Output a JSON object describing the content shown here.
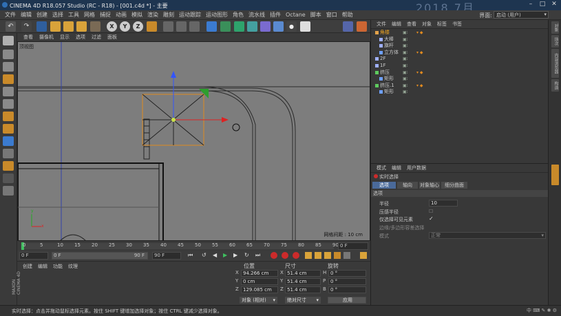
{
  "app": {
    "title": "CINEMA 4D R18.057 Studio (RC - R18) - [001.c4d *] - 主要",
    "watermark": "2018  7月"
  },
  "menu": [
    "文件",
    "编辑",
    "创建",
    "选择",
    "工具",
    "网格",
    "捕捉",
    "动画",
    "模拟",
    "渲染",
    "雕刻",
    "运动跟踪",
    "运动图形",
    "角色",
    "流水线",
    "插件",
    "Octane",
    "脚本",
    "窗口",
    "帮助"
  ],
  "layout": {
    "label": "界面:",
    "value": "启动 (用户)"
  },
  "toolbar": {
    "undo_icon": "undo-icon",
    "axis_x": "X",
    "axis_y": "Y",
    "axis_z": "Z"
  },
  "viewport": {
    "menu": [
      "查看",
      "摄像机",
      "显示",
      "选项",
      "过滤",
      "面板"
    ],
    "name": "顶视图",
    "grid_spacing": "网格间距 : 10 cm"
  },
  "timeline": {
    "ticks": [
      "0",
      "5",
      "10",
      "15",
      "20",
      "25",
      "30",
      "35",
      "40",
      "45",
      "50",
      "55",
      "60",
      "65",
      "70",
      "75",
      "80",
      "85",
      "90"
    ],
    "current": "0 F"
  },
  "transport": {
    "start": "0 F",
    "min": "0 F",
    "max": "90 F",
    "end": "90 F"
  },
  "material": {
    "menu": [
      "创建",
      "编辑",
      "功能",
      "纹理"
    ],
    "logo_line1": "MAXON",
    "logo_line2": "CINEMA 4D"
  },
  "coords": {
    "headers": {
      "pos": "位置",
      "size": "尺寸",
      "rot": "旋转"
    },
    "rows": [
      {
        "axis": "X",
        "pos": "94.266 cm",
        "saxis": "X",
        "size": "51.4 cm",
        "raxis": "H",
        "rot": "0 °"
      },
      {
        "axis": "Y",
        "pos": "0 cm",
        "saxis": "Y",
        "size": "51.4 cm",
        "raxis": "P",
        "rot": "0 °"
      },
      {
        "axis": "Z",
        "pos": "129.085 cm",
        "saxis": "Z",
        "size": "51.4 cm",
        "raxis": "B",
        "rot": "0 °"
      }
    ],
    "mode": "对象 (相对)",
    "size_mode": "绝对尺寸",
    "apply": "应用"
  },
  "objects": {
    "menu": [
      "文件",
      "编辑",
      "查看",
      "对象",
      "标签",
      "书签"
    ],
    "items": [
      {
        "name": "角楼",
        "indent": 0,
        "color": "#e3a24a"
      },
      {
        "name": "大棒",
        "indent": 1,
        "color": "#9fb0ff"
      },
      {
        "name": "旗杆",
        "indent": 1,
        "color": "#9fb0ff"
      },
      {
        "name": "立方体",
        "indent": 1,
        "color": "#6ea0ff"
      },
      {
        "name": "2F",
        "indent": 0,
        "color": "#9fb0ff"
      },
      {
        "name": "1F",
        "indent": 0,
        "color": "#9fb0ff"
      },
      {
        "name": "挤压",
        "indent": 0,
        "color": "#5ecb5e"
      },
      {
        "name": "矩形",
        "indent": 1,
        "color": "#6ea0ff"
      },
      {
        "name": "挤压.1",
        "indent": 0,
        "color": "#5ecb5e"
      },
      {
        "name": "矩形",
        "indent": 1,
        "color": "#6ea0ff"
      }
    ]
  },
  "attributes": {
    "menu": [
      "模式",
      "编辑",
      "用户数据"
    ],
    "title": "实时选择",
    "tabs": [
      "选项",
      "轴向",
      "对象轴心",
      "细分曲面"
    ],
    "section": "选项",
    "radius_label": "半径",
    "radius_value": "10",
    "pressure_label": "压感半径",
    "visible_only_label": "仅选择可见元素",
    "edge_label": "边缘/多边形容差选择",
    "mode_label": "模式",
    "mode_value": "正常"
  },
  "status": "实时选择：点击并拖动鼠标选择元素。按住 SHIFT 键增加选择对象；按住 CTRL 键减少选择对象。",
  "sidebar": [
    "对象",
    "场次",
    "内容浏览器",
    "构造"
  ],
  "colors": {
    "accent": "#e8a020",
    "selection": "#e08a20",
    "viewport_bg": "#7d7d7d"
  }
}
